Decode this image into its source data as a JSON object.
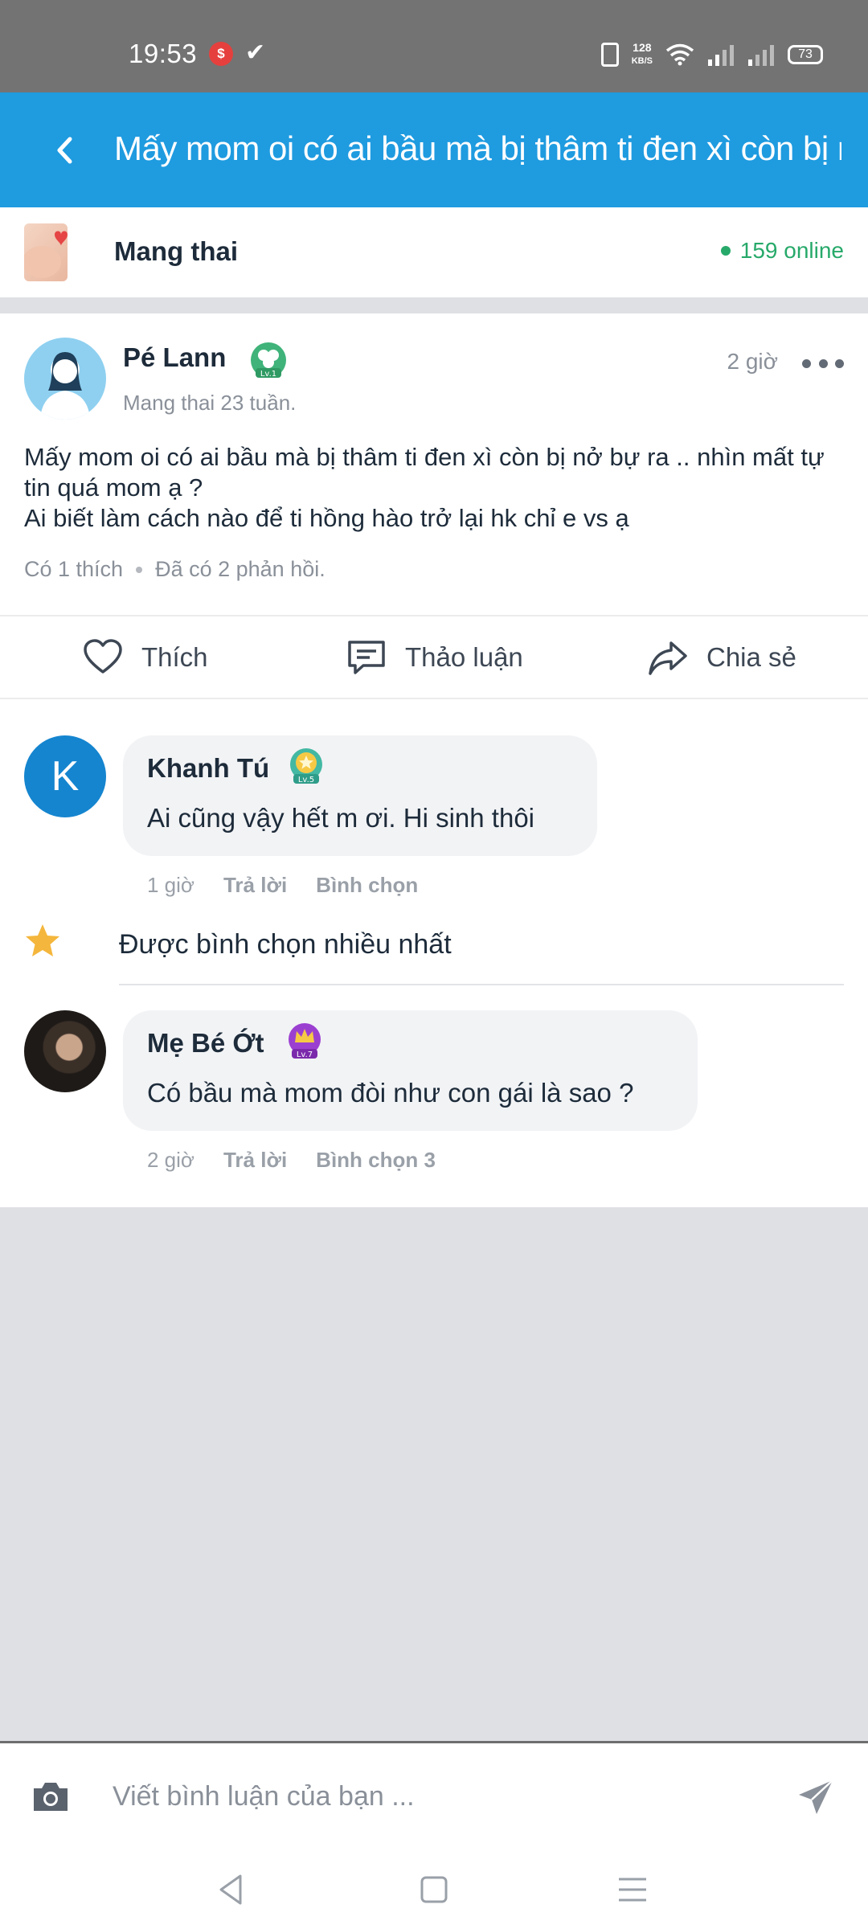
{
  "status_bar": {
    "time": "19:53",
    "notification_badge": "$",
    "network_speed_value": "128",
    "network_speed_unit": "KB/S",
    "battery": "73"
  },
  "header": {
    "title": "Mấy mom oi có ai bầu mà bị thâm ti đen xì còn bị nở bự",
    "color": "#1f9be0"
  },
  "group": {
    "name": "Mang thai",
    "online": "159 online"
  },
  "post": {
    "author": "Pé Lann",
    "author_level": "Lv.1",
    "author_status": "Mang thai 23 tuần.",
    "time": "2 giờ",
    "body": "Mấy mom oi có ai bầu mà bị thâm ti đen xì còn bị nở bự ra .. nhìn mất tự tin quá mom ạ ?\nAi biết làm cách nào để ti hồng hào trở lại hk chỉ e vs ạ",
    "likes_text": "Có 1 thích",
    "replies_text": "Đã có 2 phản hồi."
  },
  "actions": {
    "like": "Thích",
    "discuss": "Thảo luận",
    "share": "Chia sẻ"
  },
  "comments": [
    {
      "avatar_letter": "K",
      "name": "Khanh Tú",
      "level": "Lv.5",
      "text": "Ai cũng vậy hết m ơi. Hi sinh thôi",
      "time": "1 giờ",
      "reply": "Trả lời",
      "vote": "Bình chọn"
    },
    {
      "name": "Mẹ Bé Ớt",
      "level": "Lv.7",
      "text": "Có bầu mà mom đòi như con gái là sao ?",
      "time": "2 giờ",
      "reply": "Trả lời",
      "vote": "Bình chọn 3"
    }
  ],
  "top_voted_label": "Được bình chọn nhiều nhất",
  "comment_input": {
    "placeholder": "Viết bình luận của bạn ..."
  }
}
